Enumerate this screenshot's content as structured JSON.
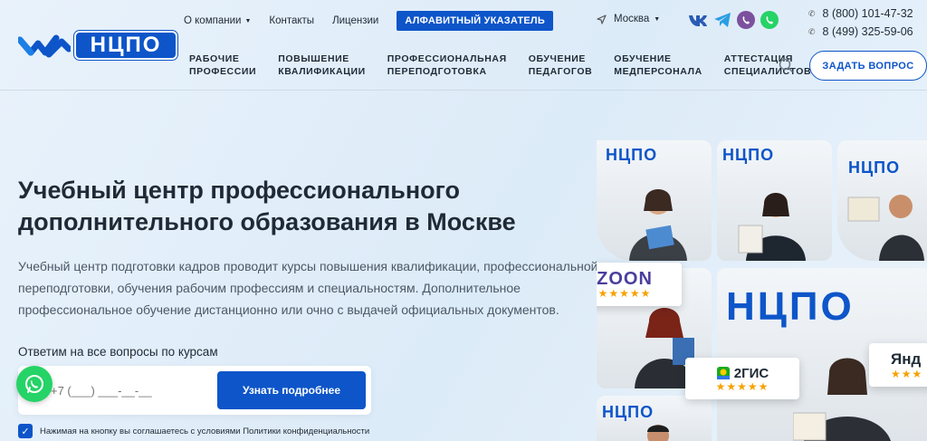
{
  "logo": {
    "text": "НЦПО"
  },
  "top_nav": [
    {
      "label": "О компании",
      "has_caret": true
    },
    {
      "label": "Контакты",
      "has_caret": false
    },
    {
      "label": "Лицензии",
      "has_caret": false
    }
  ],
  "alphabet_button": "АЛФАВИТНЫЙ УКАЗАТЕЛЬ",
  "city": {
    "label": "Москва"
  },
  "socials": [
    "vk-icon",
    "telegram-icon",
    "viber-icon",
    "whatsapp-icon"
  ],
  "phones": [
    "8 (800) 101-47-32",
    "8 (499) 325-59-06"
  ],
  "main_nav": [
    "РАБОЧИЕ\nПРОФЕССИИ",
    "ПОВЫШЕНИЕ\nКВАЛИФИКАЦИИ",
    "ПРОФЕССИОНАЛЬНАЯ\nПЕРЕПОДГОТОВКА",
    "ОБУЧЕНИЕ\nПЕДАГОГОВ",
    "ОБУЧЕНИЕ\nМЕДПЕРСОНАЛА",
    "АТТЕСТАЦИЯ\nСПЕЦИАЛИСТОВ"
  ],
  "ask_button": "ЗАДАТЬ ВОПРОС",
  "hero": {
    "title": "Учебный центр профессионального дополнительного образования в Москве",
    "description": "Учебный центр подготовки кадров проводит курсы повышения квалификации, профессиональной переподготовки, обучения рабочим профессиям и специальностям. Дополнительное профессиональное обучение дистанционно или очно с выдачей официальных документов."
  },
  "form": {
    "label": "Ответим на все вопросы по курсам",
    "phone_placeholder": "+7 (___) ___-__-__",
    "submit_label": "Узнать подробнее",
    "consent_checked": true,
    "consent_text": "Нажимая на кнопку вы соглашаетесь с условиями Политики конфиденциальности"
  },
  "badges": {
    "zoon": {
      "name": "ZOON",
      "stars": "★★★★★"
    },
    "gis": {
      "name": "2ГИС",
      "stars": "★★★★★"
    },
    "yandex": {
      "name": "Янд",
      "stars": "★★★"
    }
  },
  "photo_brand": "НЦПО",
  "colors": {
    "primary": "#0d55c9",
    "text": "#1f2a36",
    "whatsapp": "#25d366",
    "viber": "#7b519d",
    "star": "#f6a200"
  }
}
